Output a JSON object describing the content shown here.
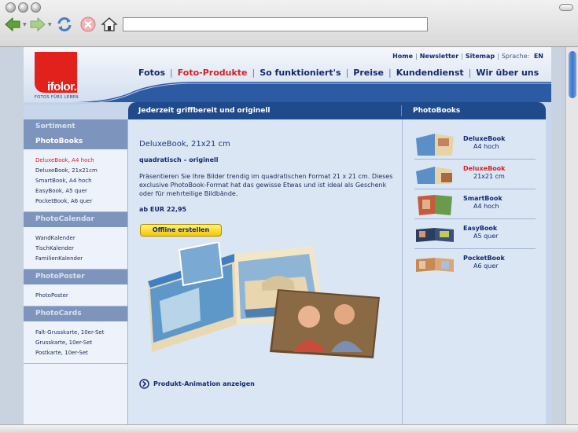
{
  "browser": {
    "url": ""
  },
  "header": {
    "logo_text": "ifolor.",
    "logo_tagline": "FOTOS FÜRS LEBEN",
    "util_links": [
      "Home",
      "Newsletter",
      "Sitemap"
    ],
    "language_label": "Sprache:",
    "language_value": "EN",
    "nav": [
      "Fotos",
      "Foto-Produkte",
      "So funktioniert's",
      "Preise",
      "Kundendienst",
      "Wir über uns"
    ],
    "active_nav": "Foto-Produkte"
  },
  "sidebar": {
    "title": "Sortiment",
    "sections": [
      {
        "title": "PhotoBooks",
        "items": [
          "DeluxeBook, A4 hoch",
          "DeluxeBook, 21x21cm",
          "SmartBook, A4 hoch",
          "EasyBook, A5 quer",
          "PocketBook, A6 quer"
        ]
      },
      {
        "title": "PhotoCalendar",
        "items": [
          "WandKalender",
          "TischKalender",
          "FamilienKalender"
        ]
      },
      {
        "title": "PhotoPoster",
        "items": [
          "PhotoPoster"
        ]
      },
      {
        "title": "PhotoCards",
        "items": [
          "Falt-Grusskarte, 10er-Set",
          "Grusskarte, 10er-Set",
          "Postkarte, 10er-Set"
        ]
      }
    ]
  },
  "content": {
    "bar_title": "Jederzeit griffbereit und originell",
    "side_title": "PhotoBooks",
    "product_title": "DeluxeBook, 21x21 cm",
    "product_subtitle": "quadratisch – originell",
    "description": "Präsentieren Sie Ihre Bilder trendig im quadratischen Format 21 x 21 cm. Dieses exclusive PhotoBook-Format hat das gewisse Etwas und ist ideal als Geschenk oder für mehrteilige Bildbände.",
    "price": "ab EUR 22,95",
    "offline_button": "Offline erstellen",
    "animation_link": "Produkt-Animation anzeigen"
  },
  "photobooks": [
    {
      "name": "DeluxeBook",
      "size": "A4 hoch"
    },
    {
      "name": "DeluxeBook",
      "size": "21x21 cm"
    },
    {
      "name": "SmartBook",
      "size": "A4 hoch"
    },
    {
      "name": "EasyBook",
      "size": "A5 quer"
    },
    {
      "name": "PocketBook",
      "size": "A6 quer"
    }
  ],
  "colors": {
    "brand_red": "#e2211c",
    "navy": "#13296e",
    "content_bar": "#1f4a8c"
  }
}
